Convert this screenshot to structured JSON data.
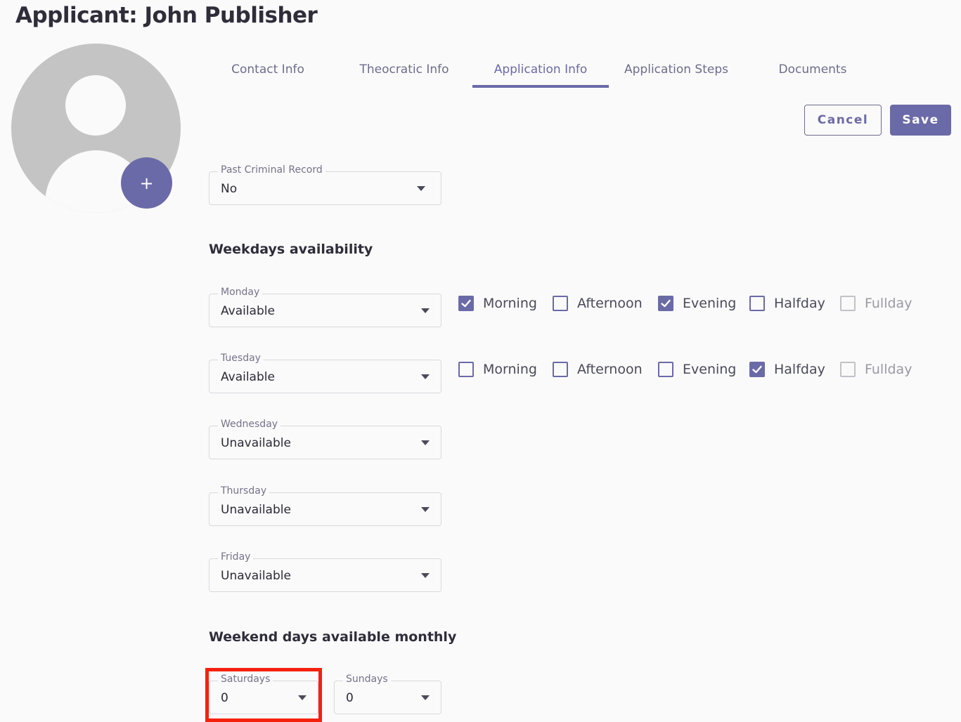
{
  "header": {
    "title": "Applicant: John Publisher"
  },
  "avatar": {
    "add_icon": "plus-icon",
    "add_glyph": "+"
  },
  "tabs": [
    {
      "label": "Contact Info",
      "active": false
    },
    {
      "label": "Theocratic Info",
      "active": false
    },
    {
      "label": "Application Info",
      "active": true
    },
    {
      "label": "Application Steps",
      "active": false
    },
    {
      "label": "Documents",
      "active": false
    }
  ],
  "actions": {
    "cancel_label": "Cancel",
    "save_label": "Save"
  },
  "criminal_record": {
    "label": "Past Criminal Record",
    "value": "No"
  },
  "weekdays": {
    "title": "Weekdays availability",
    "options": [
      "Morning",
      "Afternoon",
      "Evening",
      "Halfday",
      "Fullday"
    ],
    "days": [
      {
        "label": "Monday",
        "value": "Available",
        "checks": [
          true,
          false,
          true,
          false,
          false
        ]
      },
      {
        "label": "Tuesday",
        "value": "Available",
        "checks": [
          false,
          false,
          false,
          true,
          false
        ]
      },
      {
        "label": "Wednesday",
        "value": "Unavailable"
      },
      {
        "label": "Thursday",
        "value": "Unavailable"
      },
      {
        "label": "Friday",
        "value": "Unavailable"
      }
    ]
  },
  "weekends": {
    "title": "Weekend days available monthly",
    "saturdays": {
      "label": "Saturdays",
      "value": "0"
    },
    "sundays": {
      "label": "Sundays",
      "value": "0"
    }
  },
  "colors": {
    "accent": "#6b6aa8",
    "highlight": "#f4210d",
    "avatar_gray": "#c4c4c4"
  }
}
